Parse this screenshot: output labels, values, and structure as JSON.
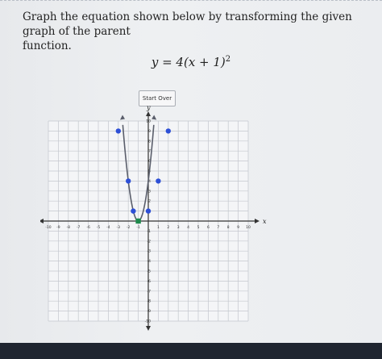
{
  "prompt": {
    "line1": "Graph the equation shown below by transforming the given graph of the parent",
    "line2": "function."
  },
  "equation": {
    "lhs": "y = 4(x + 1)",
    "exponent": "2"
  },
  "buttons": {
    "start_over": "Start Over"
  },
  "graph": {
    "x_axis_label": "x",
    "y_axis_label": "y",
    "x_ticks": [
      -10,
      -9,
      -8,
      -7,
      -6,
      -5,
      -4,
      -3,
      -2,
      -1,
      1,
      2,
      3,
      4,
      5,
      6,
      7,
      8,
      9,
      10
    ],
    "y_ticks": [
      -10,
      -9,
      -8,
      -7,
      -6,
      -5,
      -4,
      -3,
      -2,
      -1,
      1,
      2,
      3,
      4,
      5,
      6,
      7,
      8,
      9,
      10
    ],
    "x_range": [
      -10,
      10
    ],
    "y_range": [
      -10,
      10
    ],
    "curve_color": "#5a5e6b",
    "point_color": "#2d4fd6",
    "vertex_color": "#1e8a4c",
    "points": [
      {
        "x": -3,
        "y": 9
      },
      {
        "x": -2,
        "y": 4
      },
      {
        "x": -1.5,
        "y": 1
      },
      {
        "x": -1,
        "y": 0
      },
      {
        "x": 0,
        "y": 1
      },
      {
        "x": 1,
        "y": 4
      },
      {
        "x": 2,
        "y": 9
      }
    ]
  }
}
